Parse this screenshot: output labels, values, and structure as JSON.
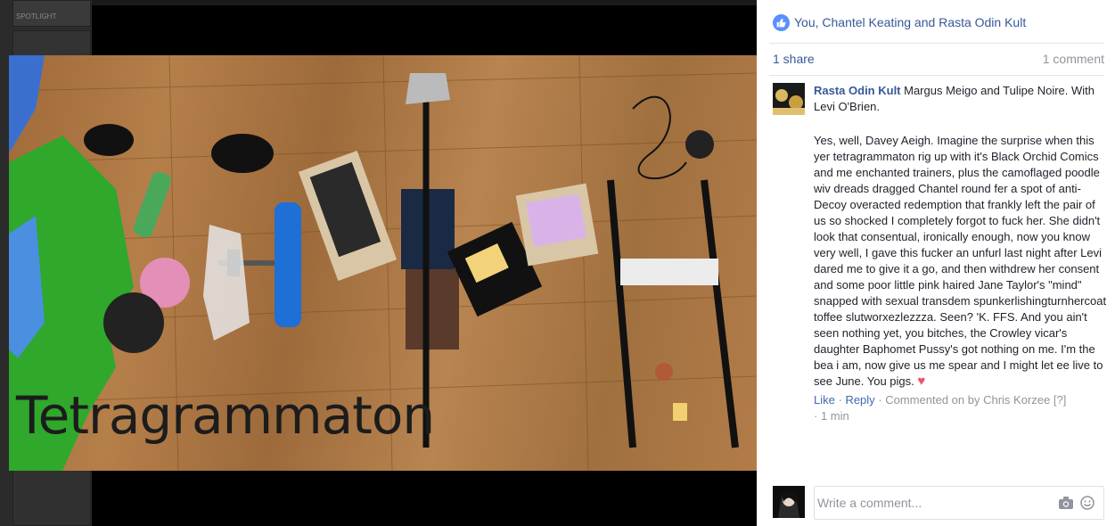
{
  "viewer": {
    "left_strip_label": "SPOTLIGHT",
    "photo_caption": "Tetragrammaton"
  },
  "reactions": {
    "icon": "thumbs-up-icon",
    "likers_text": "You, Chantel Keating and Rasta Odin Kult"
  },
  "counts": {
    "shares": "1 share",
    "comments": "1 comment"
  },
  "comment": {
    "author": "Rasta Odin Kult",
    "tags": " Margus Meigo and Tulipe Noire. With Levi O'Brien.",
    "text": "Yes, well, Davey Aeigh. Imagine the surprise when this yer tetragrammaton rig up with it's Black Orchid Comics and me enchanted trainers, plus the camoflaged poodle wiv dreads dragged Chantel round fer a spot of anti-Decoy overacted redemption that frankly left the pair of us so shocked I completely forgot to fuck her. She didn't look that consentual, ironically enough, now you know very well, I gave this fucker an unfurl last night after Levi dared me to give it a go, and then withdrew her consent and some poor little pink haired Jane Taylor's \"mind\" snapped with sexual transdem spunkerlishingturnhercoat toffee slutworxezlezzza. Seen? 'K. FFS. And you ain't seen nothing yet, you bitches, the Crowley vicar's daughter Baphomet Pussy's got nothing on me. I'm the bea i am, now give us me spear and I might let ee live to see June. You pigs.",
    "emoji": "heart",
    "like_label": "Like",
    "reply_label": "Reply",
    "commented_on": "Commented on by Chris Korzee [?]",
    "time": "1 min"
  },
  "composer": {
    "placeholder": "Write a comment...",
    "camera_icon": "camera-icon",
    "emoji_icon": "smiley-icon"
  }
}
